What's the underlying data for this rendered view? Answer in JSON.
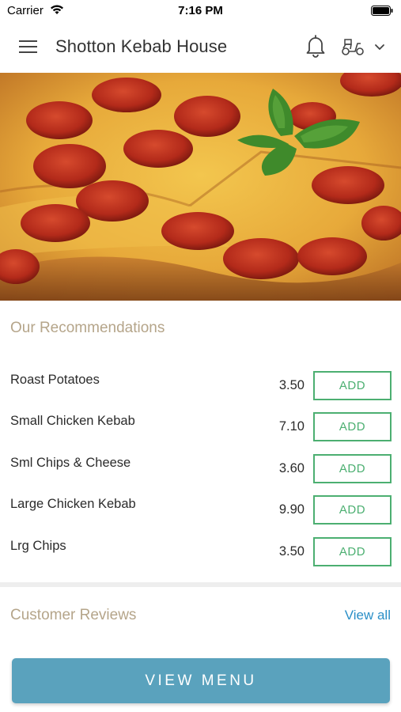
{
  "status_bar": {
    "carrier": "Carrier",
    "time": "7:16 PM",
    "icons": [
      "wifi-icon",
      "battery-icon"
    ]
  },
  "header": {
    "title": "Shotton Kebab House",
    "icons": [
      "menu-icon",
      "bell-icon",
      "scooter-icon",
      "chevron-down-icon"
    ]
  },
  "hero": {
    "image": "pepperoni pizza with basil"
  },
  "recommendations": {
    "title": "Our Recommendations",
    "add_label": "ADD",
    "items": [
      {
        "name": "Roast Potatoes",
        "price": "3.50"
      },
      {
        "name": "Small Chicken Kebab",
        "price": "7.10"
      },
      {
        "name": "Sml Chips & Cheese",
        "price": "3.60"
      },
      {
        "name": "Large Chicken Kebab",
        "price": "9.90"
      },
      {
        "name": "Lrg Chips",
        "price": "3.50"
      }
    ]
  },
  "reviews": {
    "title": "Customer Reviews",
    "view_all": "View all"
  },
  "footer": {
    "view_menu": "VIEW MENU"
  },
  "colors": {
    "accent_green": "#4caf71",
    "section_title": "#b5a58a",
    "link_blue": "#2a8fc7",
    "button_blue": "#5aa2bd"
  }
}
